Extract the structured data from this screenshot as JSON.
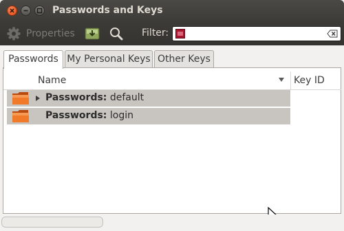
{
  "window": {
    "title": "Passwords and Keys",
    "close_icon": "close-icon",
    "minimize_icon": "minimize-icon",
    "maximize_icon": "maximize-icon"
  },
  "toolbar": {
    "properties_label": "Properties",
    "properties_icon": "gear-icon",
    "import_icon": "import-icon",
    "find_icon": "search-icon",
    "filter_label": "Filter:",
    "filter_value": "",
    "filter_clear_icon": "clear-icon"
  },
  "tabs": [
    {
      "label": "Passwords",
      "active": true
    },
    {
      "label": "My Personal Keys",
      "active": false
    },
    {
      "label": "Other Keys",
      "active": false
    }
  ],
  "list": {
    "columns": [
      {
        "label": "Name"
      },
      {
        "label": "Key ID"
      }
    ],
    "sort_icon": "sort-down-icon",
    "rows": [
      {
        "bold": "Passwords:",
        "name": "default",
        "icon": "folder-icon",
        "expander": "expander-icon"
      },
      {
        "bold": "Passwords:",
        "name": "login",
        "icon": "folder-icon",
        "expander": ""
      }
    ]
  },
  "colors": {
    "titlebar": "#3c3b37",
    "row_selected": "#c8c5c0",
    "close_button": "#df4a16",
    "folder": "#e8661c"
  }
}
